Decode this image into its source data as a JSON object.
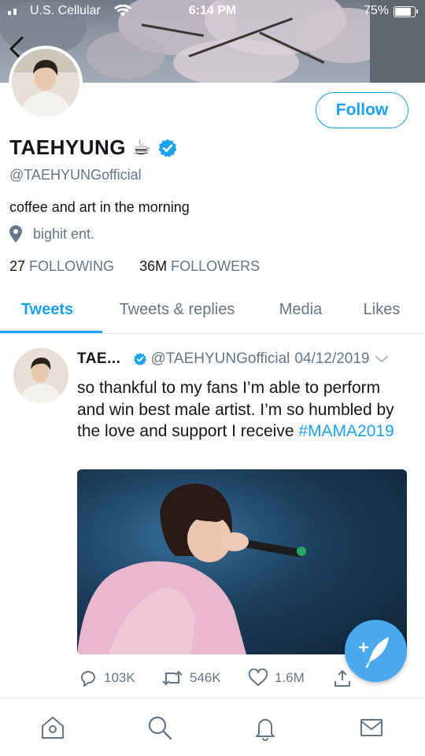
{
  "status_bar": {
    "carrier": "U.S. Cellular",
    "time": "6:14 PM",
    "battery": "75%"
  },
  "profile": {
    "follow_label": "Follow",
    "display_name": "TAEHYUNG",
    "name_emoji": "☕",
    "handle": "@TAEHYUNGofficial",
    "bio": "coffee and art in the morning",
    "location": "bighit ent.",
    "following_count": "27",
    "following_label": "FOLLOWING",
    "followers_count": "36M",
    "followers_label": "FOLLOWERS"
  },
  "tabs": [
    {
      "label": "Tweets",
      "active": true
    },
    {
      "label": "Tweets & replies",
      "active": false
    },
    {
      "label": "Media",
      "active": false
    },
    {
      "label": "Likes",
      "active": false
    }
  ],
  "tweet": {
    "name": "TAE...",
    "handle": "@TAEHYUNGofficial",
    "date": "04/12/2019",
    "text": "so thankful to my fans I’m able to perform and win best male artist. I’m so humbled by the love and support I receive ",
    "hashtag": "#MAMA2019",
    "replies": "103K",
    "retweets": "546K",
    "likes": "1.6M"
  },
  "icons": {
    "back": "chevron-left-icon",
    "verified": "verified-badge-icon",
    "location": "location-pin-icon",
    "reply": "reply-icon",
    "retweet": "retweet-icon",
    "like": "heart-icon",
    "share": "share-icon",
    "compose": "compose-tweet-icon",
    "home": "home-icon",
    "search": "search-icon",
    "notifications": "bell-icon",
    "messages": "mail-icon"
  },
  "colors": {
    "accent": "#1da1f2",
    "muted_text": "#657786",
    "primary_text": "#14171a",
    "fab": "#4aa9ee"
  }
}
